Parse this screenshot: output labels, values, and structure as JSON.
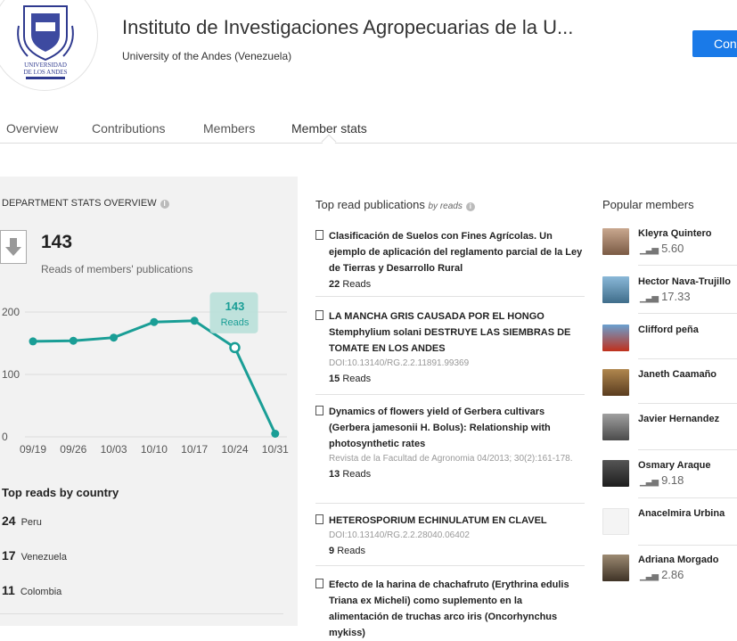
{
  "header": {
    "logo_text": "UNIVERSIDAD DE LOS ANDES",
    "title": "Instituto de Investigaciones Agropecuarias de la U...",
    "subtitle": "University of the Andes (Venezuela)",
    "connect_label": "Con"
  },
  "tabs": [
    {
      "label": "Overview"
    },
    {
      "label": "Contributions"
    },
    {
      "label": "Members"
    },
    {
      "label": "Member stats",
      "active": true
    }
  ],
  "overview": {
    "title": "DEPARTMENT STATS OVERVIEW",
    "reads_value": "143",
    "reads_label": "Reads of members' publications"
  },
  "chart_data": {
    "type": "line",
    "x": [
      "09/19",
      "09/26",
      "10/03",
      "10/10",
      "10/17",
      "10/24",
      "10/31"
    ],
    "y_ticks": [
      "0",
      "100",
      "200"
    ],
    "series": [
      {
        "values": [
          153,
          154,
          159,
          184,
          186,
          143,
          5
        ]
      }
    ],
    "ylim": [
      0,
      200
    ],
    "tooltip": {
      "value": "143",
      "label": "Reads",
      "index": 5
    },
    "color": "#1a9e96"
  },
  "countries": {
    "title": "Top reads by country",
    "items": [
      {
        "count": "24",
        "name": "Peru"
      },
      {
        "count": "17",
        "name": "Venezuela"
      },
      {
        "count": "11",
        "name": "Colombia"
      }
    ]
  },
  "publications": {
    "title": "Top read publications",
    "title_suffix": "by reads",
    "items": [
      {
        "title": "Clasificación de Suelos con Fines Agrícolas. Un ejemplo de aplicación del reglamento parcial de la Ley de Tierras y Desarrollo Rural",
        "meta": "",
        "reads": "22",
        "reads_label": "Reads"
      },
      {
        "title": "LA MANCHA GRIS CAUSADA POR EL HONGO Stemphylium solani DESTRUYE LAS SIEMBRAS DE TOMATE EN LOS ANDES",
        "meta": "DOI:10.13140/RG.2.2.11891.99369",
        "reads": "15",
        "reads_label": "Reads"
      },
      {
        "title": "Dynamics of flowers yield of Gerbera cultivars (Gerbera jamesonii H. Bolus): Relationship with photosynthetic rates",
        "meta": "Revista de la Facultad de Agronomia 04/2013; 30(2):161-178.",
        "reads": "13",
        "reads_label": "Reads"
      },
      {
        "title": "HETEROSPORIUM ECHINULATUM EN CLAVEL",
        "meta": "DOI:10.13140/RG.2.2.28040.06402",
        "reads": "9",
        "reads_label": "Reads"
      },
      {
        "title": "Efecto de la harina de chachafruto (Erythrina edulis Triana ex Micheli) como suplemento en la alimentación de truchas arco iris (Oncorhynchus mykiss)",
        "meta": "",
        "reads": "",
        "reads_label": ""
      }
    ]
  },
  "members": {
    "title": "Popular members",
    "items": [
      {
        "name": "Kleyra Quintero",
        "score": "5.60"
      },
      {
        "name": "Hector Nava-Trujillo",
        "score": "17.33"
      },
      {
        "name": "Clifford peña",
        "score": ""
      },
      {
        "name": "Janeth Caamaño",
        "score": ""
      },
      {
        "name": "Javier Hernandez",
        "score": ""
      },
      {
        "name": "Osmary Araque",
        "score": "9.18"
      },
      {
        "name": "Anacelmira Urbina",
        "score": ""
      },
      {
        "name": "Adriana Morgado",
        "score": "2.86"
      }
    ]
  }
}
